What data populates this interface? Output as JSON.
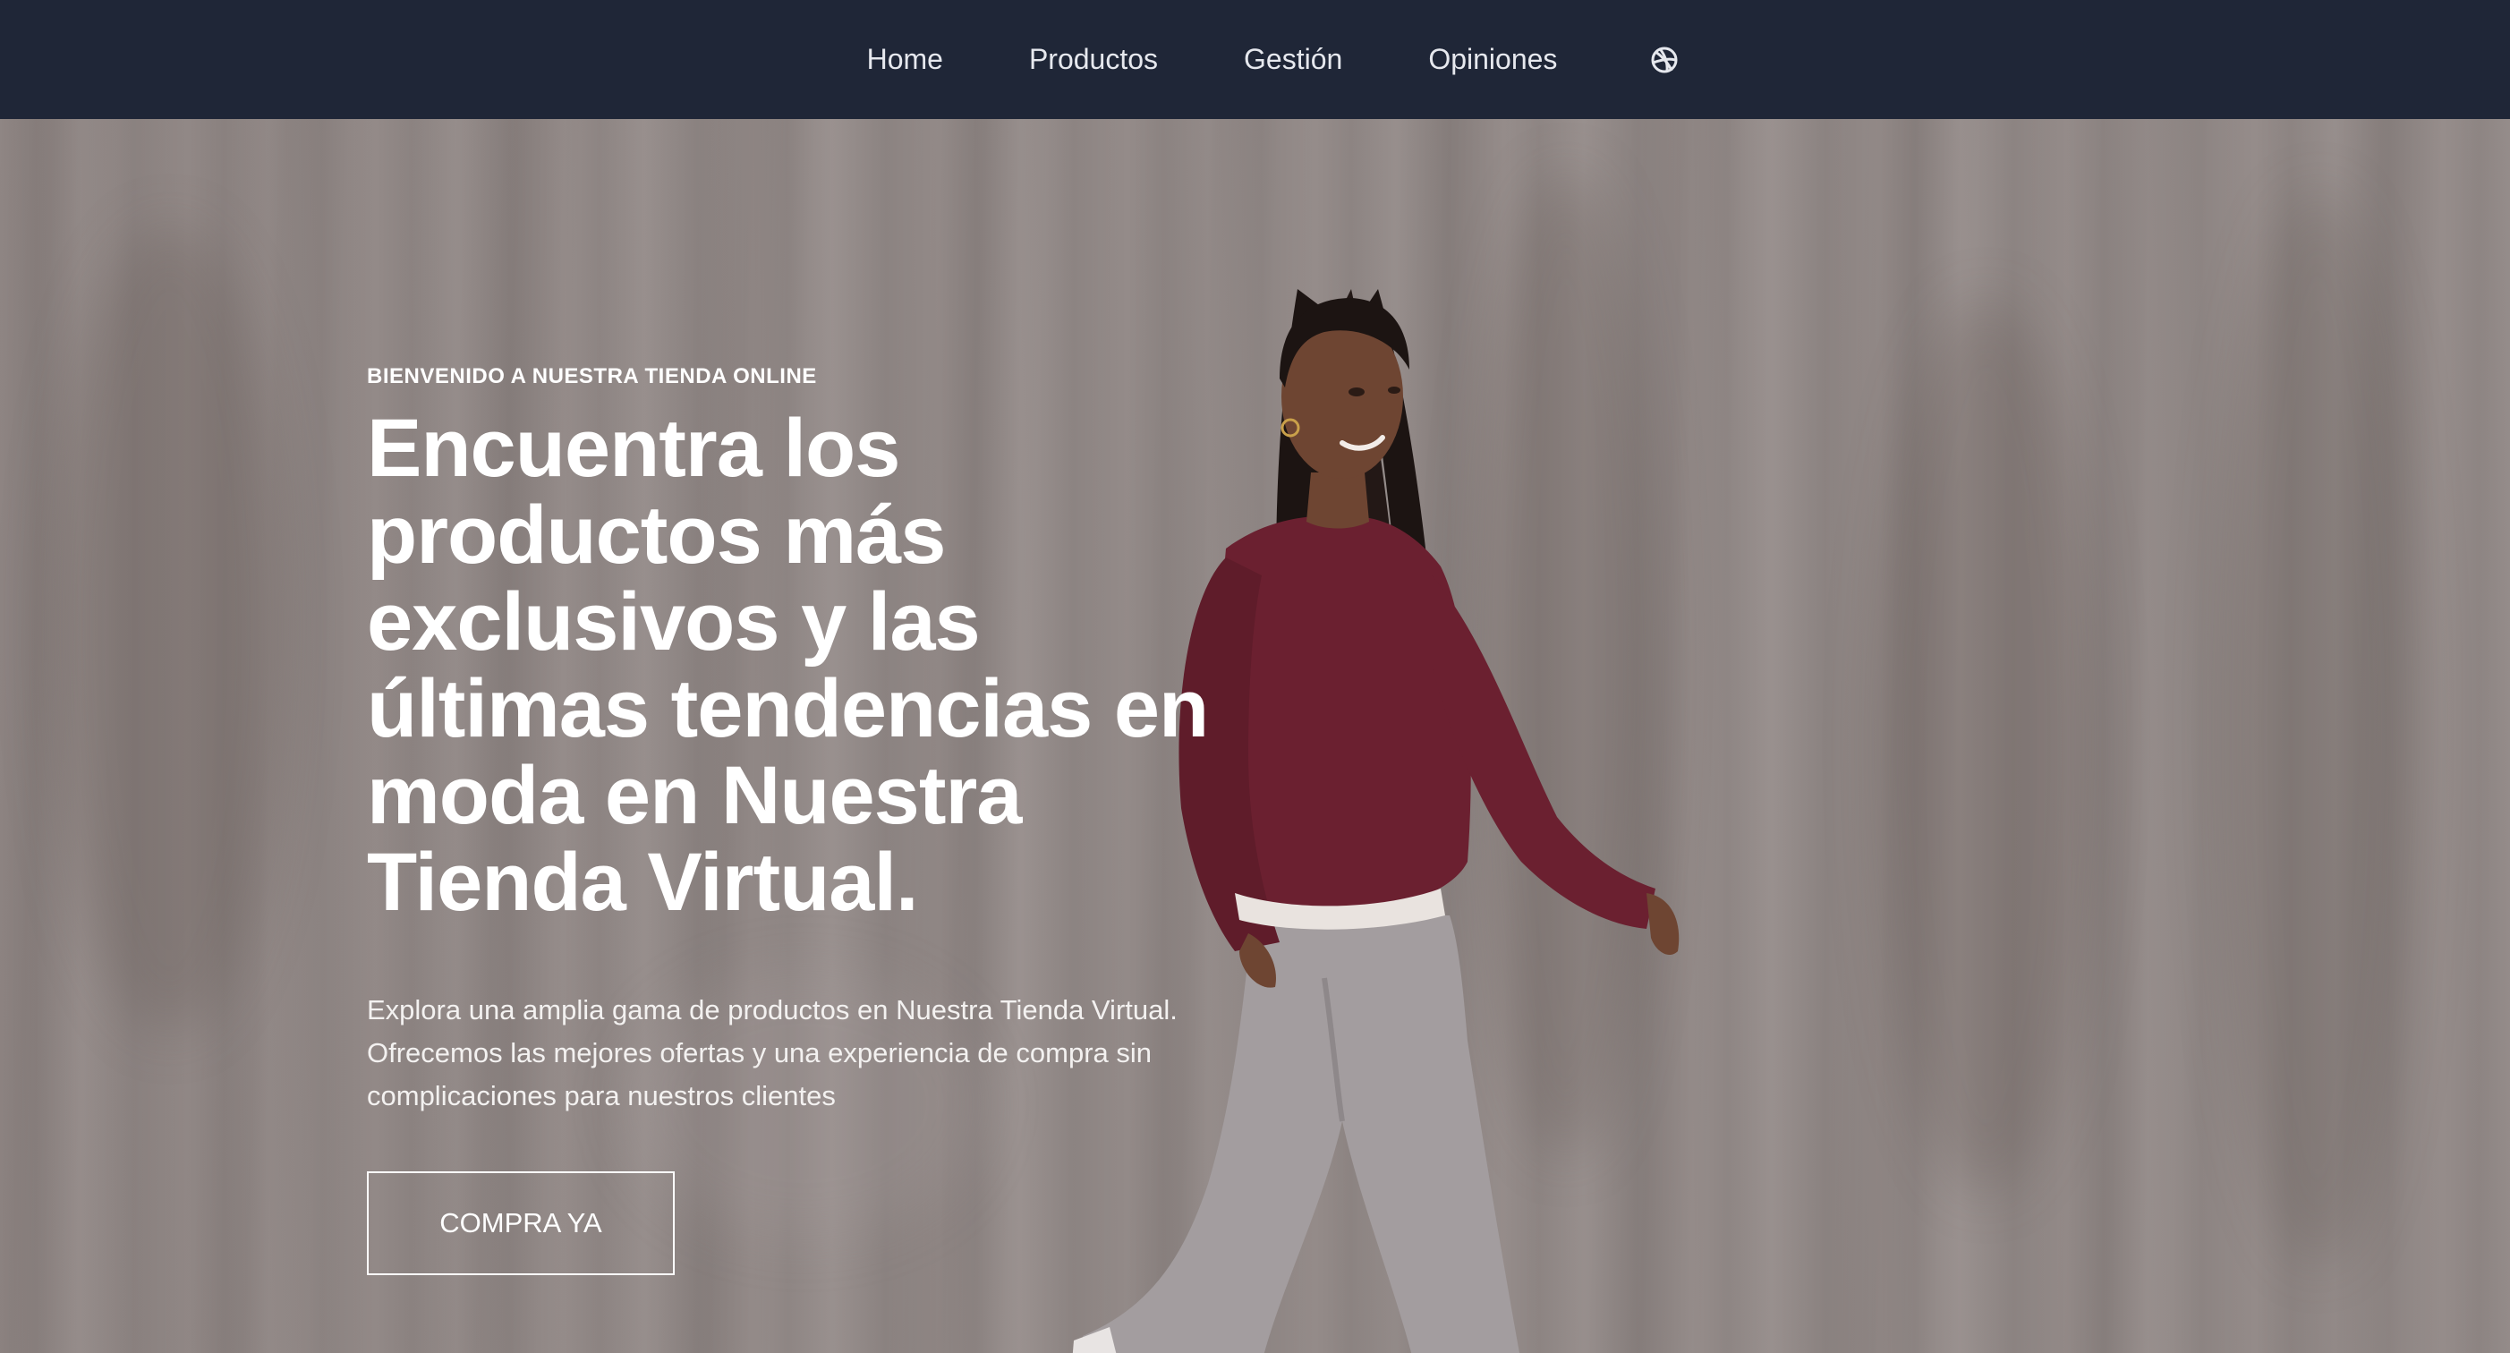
{
  "nav": {
    "items": [
      {
        "label": "Home"
      },
      {
        "label": "Productos"
      },
      {
        "label": "Gestión"
      },
      {
        "label": "Opiniones"
      }
    ],
    "icon": "dribbble-icon",
    "background": "#1f2637",
    "text_color": "#e6e8ee"
  },
  "hero": {
    "eyebrow": "BIENVENIDO A NUESTRA TIENDA ONLINE",
    "headline_lines": [
      "Encuentra los",
      "productos más",
      "exclusivos y las",
      "últimas tendencias en",
      "moda en Nuestra",
      "Tienda Virtual."
    ],
    "lead": "Explora una amplia gama de productos en Nuestra Tienda Virtual. Ofrecemos las mejores ofertas y una experiencia de compra sin complicaciones para nuestros clientes",
    "cta_label": "COMPRA YA"
  },
  "colors": {
    "sweater": "#6b2030",
    "pants": "#a39d9f",
    "skin": "#6e4532",
    "wall": "#938a88"
  }
}
